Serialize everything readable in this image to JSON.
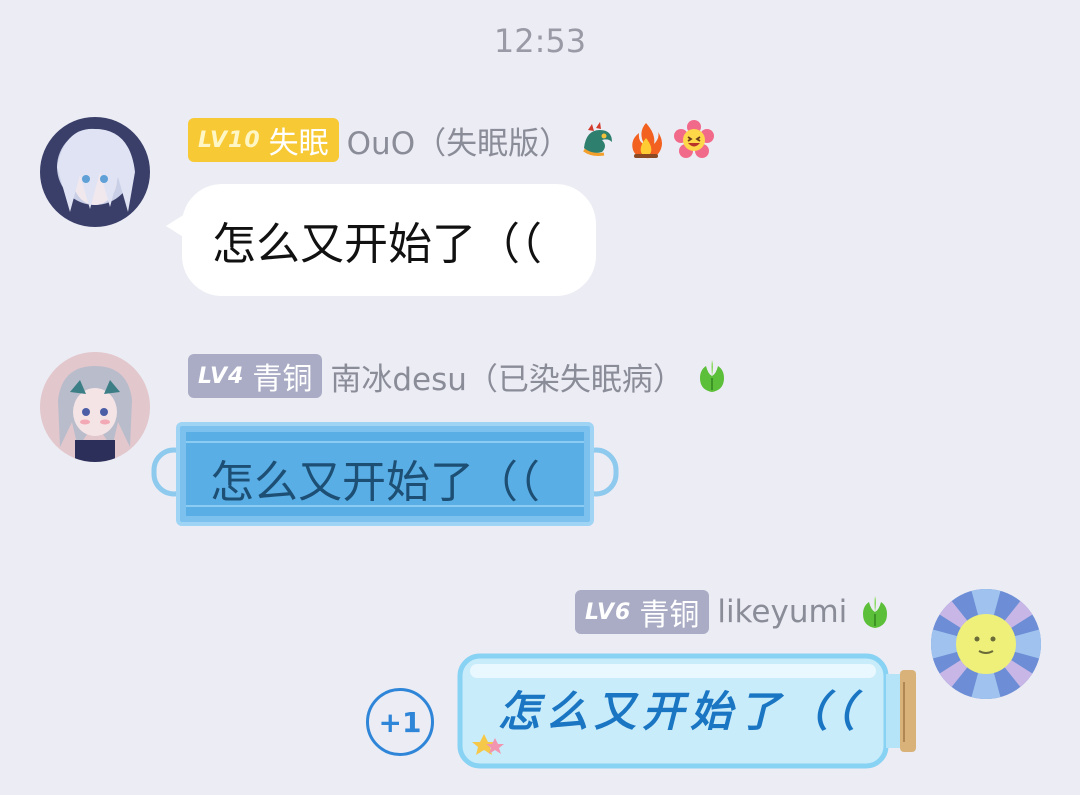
{
  "timestamp": "12:53",
  "messages": [
    {
      "badge_level": "LV10",
      "badge_title": "失眠",
      "nickname": "OuO（失眠版）",
      "icons": [
        "dragon-icon",
        "fire-icon",
        "laughing-flower-icon"
      ],
      "text": "怎么又开始了（（"
    },
    {
      "badge_level": "LV4",
      "badge_title": "青铜",
      "nickname": "南冰desu（已染失眠病）",
      "icons": [
        "sprout-icon"
      ],
      "text": "怎么又开始了（（"
    },
    {
      "badge_level": "LV6",
      "badge_title": "青铜",
      "nickname": "likeyumi",
      "icons": [
        "sprout-icon"
      ],
      "text": "怎么又开始了（（"
    }
  ],
  "plus_one": "+1",
  "colors": {
    "background": "#ececf4",
    "gold_badge": "#f7c934",
    "gray_badge": "#a9acc4",
    "plus_one": "#2f86d8"
  }
}
